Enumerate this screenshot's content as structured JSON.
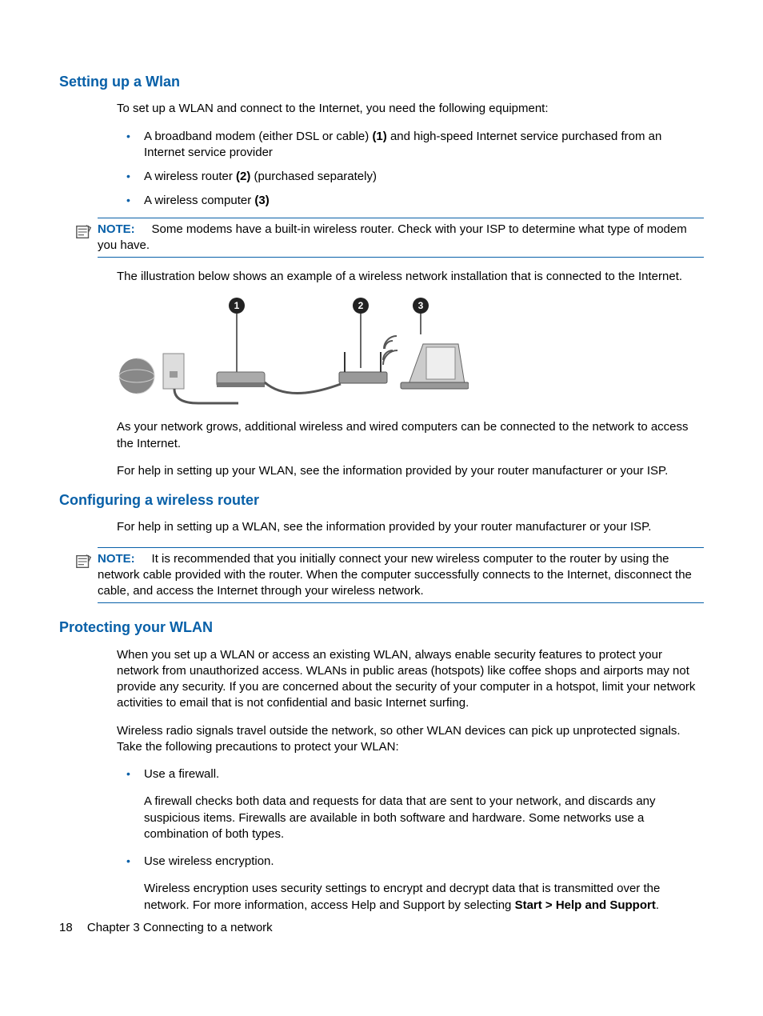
{
  "section1": {
    "title": "Setting up a Wlan",
    "intro": "To set up a WLAN and connect to the Internet, you need the following equipment:",
    "bullets": [
      {
        "pre": "A broadband modem (either DSL or cable) ",
        "bold": "(1)",
        "post": " and high-speed Internet service purchased from an Internet service provider"
      },
      {
        "pre": "A wireless router ",
        "bold": "(2)",
        "post": " (purchased separately)"
      },
      {
        "pre": "A wireless computer ",
        "bold": "(3)",
        "post": ""
      }
    ],
    "note": {
      "label": "NOTE:",
      "text": "Some modems have a built-in wireless router. Check with your ISP to determine what type of modem you have."
    },
    "afterNote": "The illustration below shows an example of a wireless network installation that is connected to the Internet.",
    "afterIllus1": "As your network grows, additional wireless and wired computers can be connected to the network to access the Internet.",
    "afterIllus2": "For help in setting up your WLAN, see the information provided by your router manufacturer or your ISP."
  },
  "section2": {
    "title": "Configuring a wireless router",
    "p1": "For help in setting up a WLAN, see the information provided by your router manufacturer or your ISP.",
    "note": {
      "label": "NOTE:",
      "text": "It is recommended that you initially connect your new wireless computer to the router by using the network cable provided with the router. When the computer successfully connects to the Internet, disconnect the cable, and access the Internet through your wireless network."
    }
  },
  "section3": {
    "title": "Protecting your WLAN",
    "p1": "When you set up a WLAN or access an existing WLAN, always enable security features to protect your network from unauthorized access. WLANs in public areas (hotspots) like coffee shops and airports may not provide any security. If you are concerned about the security of your computer in a hotspot, limit your network activities to email that is not confidential and basic Internet surfing.",
    "p2": "Wireless radio signals travel outside the network, so other WLAN devices can pick up unprotected signals. Take the following precautions to protect your WLAN:",
    "bullets": [
      {
        "head": "Use a firewall.",
        "body": "A firewall checks both data and requests for data that are sent to your network, and discards any suspicious items. Firewalls are available in both software and hardware. Some networks use a combination of both types."
      },
      {
        "head": "Use wireless encryption.",
        "bodyPre": "Wireless encryption uses security settings to encrypt and decrypt data that is transmitted over the network. For more information, access Help and Support by selecting ",
        "bodyBold": "Start > Help and Support",
        "bodyPost": "."
      }
    ]
  },
  "diagram": {
    "callouts": [
      "1",
      "2",
      "3"
    ]
  },
  "footer": {
    "page": "18",
    "chapter": "Chapter 3   Connecting to a network"
  }
}
